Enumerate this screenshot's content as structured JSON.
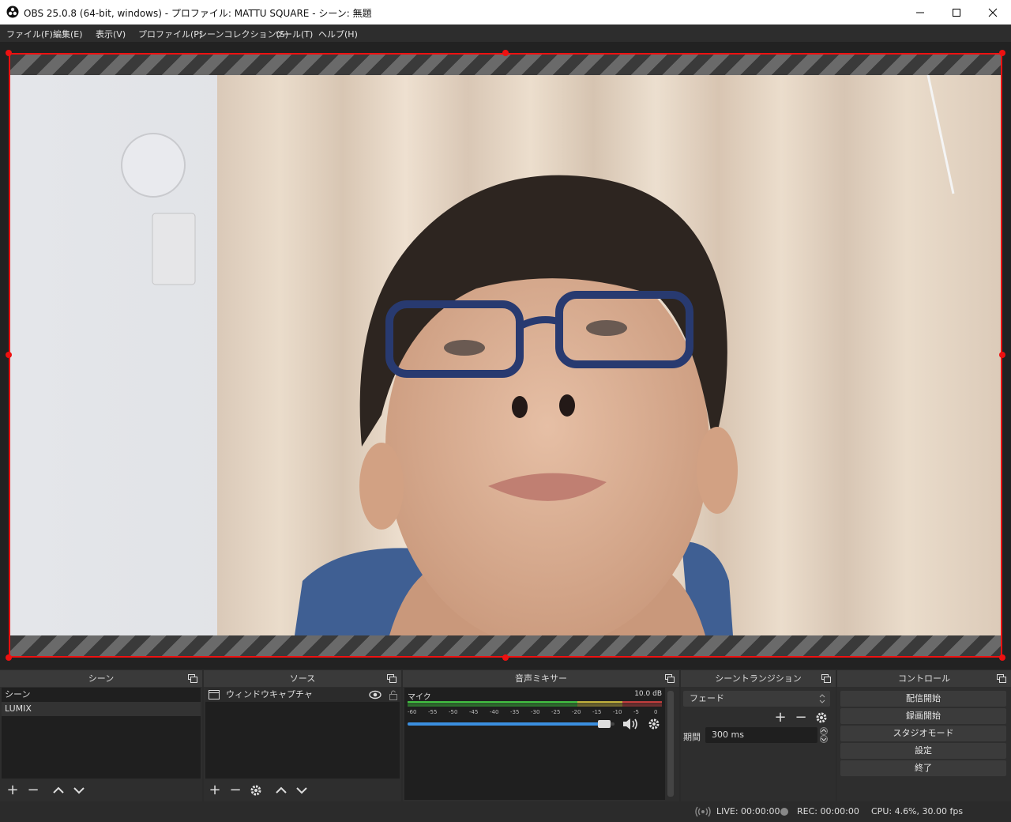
{
  "window": {
    "title": "OBS 25.0.8 (64-bit, windows) - プロファイル: MATTU SQUARE - シーン: 無題"
  },
  "menu": [
    "ファイル(F)",
    "編集(E)",
    "表示(V)",
    "プロファイル(P)",
    "シーンコレクション(S)",
    "ツール(T)",
    "ヘルプ(H)"
  ],
  "docks": {
    "scenes": {
      "title": "シーン",
      "items": [
        "シーン",
        "LUMIX"
      ]
    },
    "sources": {
      "title": "ソース",
      "items": [
        "ウィンドウキャプチャ"
      ]
    },
    "mixer": {
      "title": "音声ミキサー",
      "channel_name": "マイク",
      "db_value": "10.0 dB",
      "scale": [
        "-60",
        "-55",
        "-50",
        "-45",
        "-40",
        "-35",
        "-30",
        "-25",
        "-20",
        "-15",
        "-10",
        "-5",
        "0"
      ],
      "volume_level": 0.98
    },
    "transitions": {
      "title": "シーントランジション",
      "transition": "フェード",
      "duration_label": "期間",
      "duration_value": "300 ms"
    },
    "controls": {
      "title": "コントロール",
      "buttons": [
        "配信開始",
        "録画開始",
        "スタジオモード",
        "設定",
        "終了"
      ]
    }
  },
  "status": {
    "live": "LIVE: 00:00:00",
    "rec": "REC: 00:00:00",
    "cpu": "CPU: 4.6%, 30.00 fps"
  },
  "colors": {
    "selection_border": "#ee1111",
    "volume_bar": "#3b8fe0",
    "meter_green": "#3fb23f",
    "meter_yellow": "#b3a43a",
    "meter_red": "#b33a3a"
  }
}
